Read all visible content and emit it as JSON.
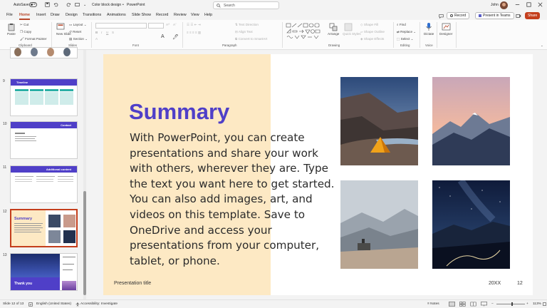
{
  "titlebar": {
    "autosave_label": "AutoSave",
    "autosave_state": "Off",
    "doc_name": "Color block design",
    "separator": "•",
    "app_name": "PowerPoint",
    "search_placeholder": "Search",
    "user_name": "John"
  },
  "menu": {
    "tabs": [
      "File",
      "Home",
      "Insert",
      "Draw",
      "Design",
      "Transitions",
      "Animations",
      "Slide Show",
      "Record",
      "Review",
      "View",
      "Help"
    ],
    "active": "Home",
    "record_button": "Record",
    "present_button": "Present in Teams",
    "share_button": "Share"
  },
  "ribbon": {
    "paste": "Paste",
    "cut": "Cut",
    "copy": "Copy",
    "format_painter": "Format Painter",
    "new_slide": "New Slide",
    "layout": "Layout",
    "reset": "Reset",
    "section": "Section",
    "text_direction": "Text Direction",
    "align_text": "Align Text",
    "convert_smartart": "Convert to SmartArt",
    "arrange": "Arrange",
    "quick_styles": "Quick Styles",
    "shape_fill": "Shape Fill",
    "shape_outline": "Shape Outline",
    "shape_effects": "Shape Effects",
    "find": "Find",
    "replace": "Replace",
    "select": "Select",
    "dictate": "Dictate",
    "designer": "Designer",
    "groups": {
      "clipboard": "Clipboard",
      "slides": "Slides",
      "font": "Font",
      "paragraph": "Paragraph",
      "drawing": "Drawing",
      "editing": "Editing",
      "voice": "Voice"
    }
  },
  "thumbnails": [
    {
      "num": "9",
      "title": "Timeline"
    },
    {
      "num": "10",
      "title": "Contact"
    },
    {
      "num": "11",
      "title": "Additional content"
    },
    {
      "num": "12",
      "title": "Summary",
      "selected": true
    },
    {
      "num": "13",
      "title": "Thank you"
    }
  ],
  "slide": {
    "title": "Summary",
    "body": "With PowerPoint, you can create presentations and share your work with others, wherever they are. Type the text you want here to get started. You can also add images, art, and videos on this template. Save to OneDrive and access your presentations from your computer, tablet, or phone.",
    "footer_left": "Presentation title",
    "footer_date": "20XX",
    "footer_num": "12"
  },
  "statusbar": {
    "slide_info": "Slide 12 of 13",
    "language": "English (United States)",
    "accessibility": "Accessibility: Investigate",
    "notes": "Notes",
    "zoom": "113%"
  },
  "colors": {
    "accent": "#b7472a",
    "title_purple": "#4f3fc8",
    "slide_cream": "#fde9c4",
    "share_orange": "#c43e1c"
  }
}
